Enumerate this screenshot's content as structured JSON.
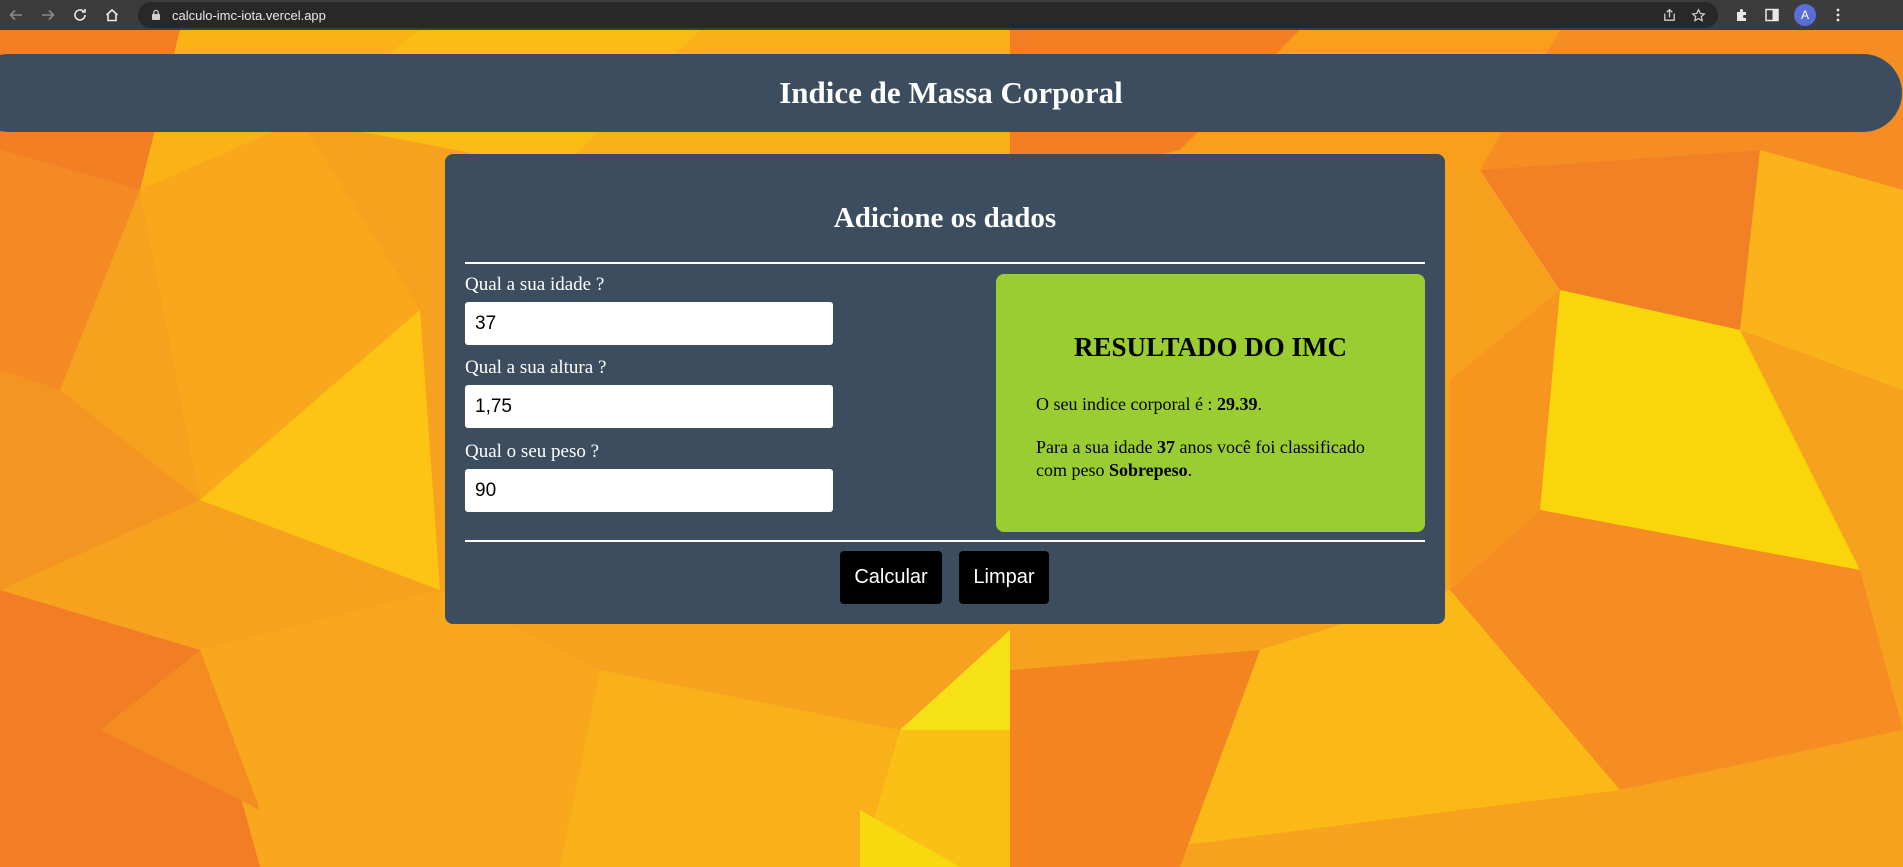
{
  "browser": {
    "url": "calculo-imc-iota.vercel.app",
    "avatar_letter": "A"
  },
  "header": {
    "title": "Indice de Massa Corporal"
  },
  "form": {
    "heading": "Adicione os dados",
    "age_label": "Qual a sua idade ?",
    "age_value": "37",
    "height_label": "Qual a sua altura ?",
    "height_value": "1,75",
    "weight_label": "Qual o seu peso ?",
    "weight_value": "90",
    "calculate_label": "Calcular",
    "clear_label": "Limpar"
  },
  "result": {
    "title": "RESULTADO DO IMC",
    "index_prefix": "O seu indice corporal é : ",
    "index_value": "29.39",
    "index_suffix": ".",
    "age_prefix": "Para a sua idade ",
    "age_value": "37",
    "age_middle": " anos você foi classificado com peso ",
    "classification": "Sobrepeso",
    "classification_suffix": "."
  },
  "colors": {
    "panel": "#3b4d5e",
    "result_bg": "#9acd32",
    "button_bg": "#000000",
    "background_orange": "#f5a623"
  }
}
